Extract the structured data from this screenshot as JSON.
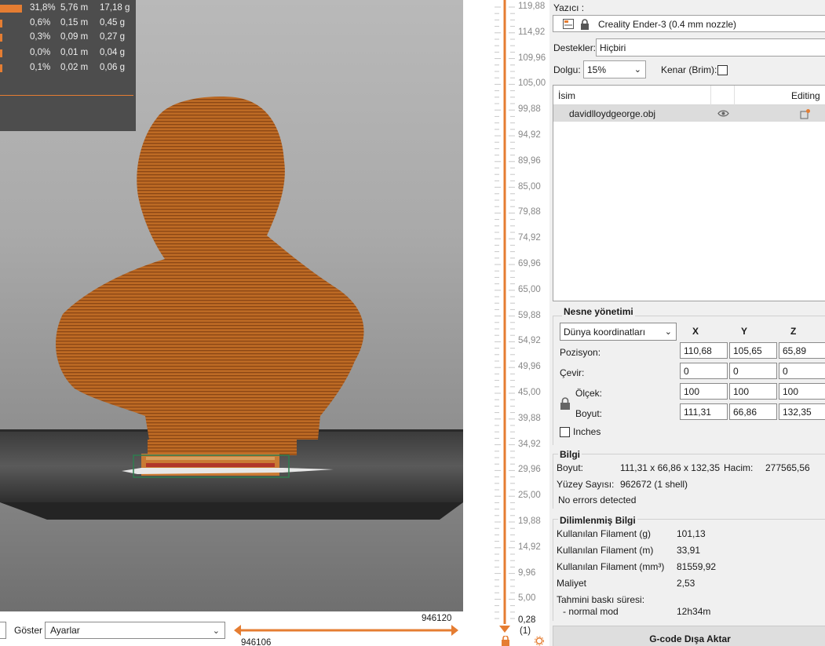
{
  "legend": {
    "rows": [
      {
        "percent": "31,8%",
        "length": "5,76 m",
        "weight": "17,18 g"
      },
      {
        "percent": "0,6%",
        "length": "0,15 m",
        "weight": "0,45 g"
      },
      {
        "percent": "0,3%",
        "length": "0,09 m",
        "weight": "0,27 g"
      },
      {
        "percent": "0,0%",
        "length": "0,01 m",
        "weight": "0,04 g"
      },
      {
        "percent": "0,1%",
        "length": "0,02 m",
        "weight": "0,06 g"
      }
    ]
  },
  "bottombar": {
    "show_label": "Göster",
    "show_value": "Ayarlar",
    "move_upper": "946120",
    "move_lower": "946106"
  },
  "layer_slider": {
    "ticks": [
      "119,88",
      "114,92",
      "109,96",
      "105,00",
      "99,88",
      "94,92",
      "89,96",
      "85,00",
      "79,88",
      "74,92",
      "69,96",
      "65,00",
      "59,88",
      "54,92",
      "49,96",
      "45,00",
      "39,88",
      "34,92",
      "29,96",
      "25,00",
      "19,88",
      "14,92",
      "9,96",
      "5,00"
    ],
    "bottom_value": "0,28",
    "bottom_layer": "(1)"
  },
  "panel": {
    "printer_label": "Yazıcı :",
    "printer_name": "Creality Ender-3 (0.4 mm nozzle)",
    "supports_label": "Destekler:",
    "supports_value": "Hiçbiri",
    "infill_label": "Dolgu:",
    "infill_value": "15%",
    "brim_label": "Kenar (Brim):",
    "list_col_name": "İsim",
    "list_col_editing": "Editing",
    "object_name": "davidlloydgeorge.obj",
    "manip_title": "Nesne yönetimi",
    "coord_system": "Dünya koordinatları",
    "axis_x": "X",
    "axis_y": "Y",
    "axis_z": "Z",
    "position_label": "Pozisyon:",
    "rotate_label": "Çevir:",
    "scale_label": "Ölçek:",
    "size_label": "Boyut:",
    "position": [
      "110,68",
      "105,65",
      "65,89"
    ],
    "rotation": [
      "0",
      "0",
      "0"
    ],
    "scale": [
      "100",
      "100",
      "100"
    ],
    "size": [
      "111,31",
      "66,86",
      "132,35"
    ],
    "inches_label": "Inches",
    "info_title": "Bilgi",
    "info_size_label": "Boyut:",
    "info_size_value": "111,31 x 66,86 x 132,35",
    "info_volume_label": "Hacim:",
    "info_volume_value": "277565,56",
    "info_facets_label": "Yüzey Sayısı:",
    "info_facets_value": "962672 (1 shell)",
    "info_errors": "No errors detected",
    "sliced_title": "Dilimlenmiş Bilgi",
    "sliced_rows": [
      {
        "label": "Kullanılan Filament (g)",
        "value": "101,13"
      },
      {
        "label": "Kullanılan Filament (m)",
        "value": "33,91"
      },
      {
        "label": "Kullanılan Filament (mm³)",
        "value": "81559,92"
      },
      {
        "label": "Maliyet",
        "value": "2,53"
      }
    ],
    "print_time_label": "Tahmini baskı süresi:",
    "print_mode_label": "- normal mod",
    "print_mode_value": "12h34m",
    "export_button": "G-code Dışa Aktar"
  },
  "colors": {
    "accent": "#e57d32",
    "model": "#b8621f",
    "legend_bg": "#4d4d4d",
    "panel_bg": "#f0f0f0"
  }
}
